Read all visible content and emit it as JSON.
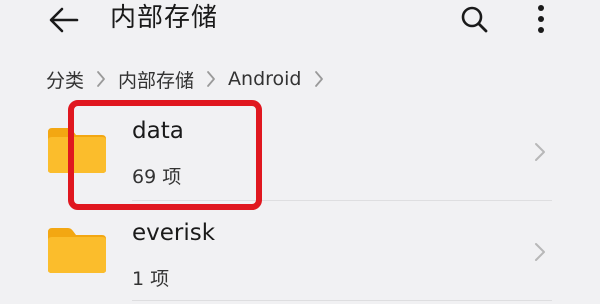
{
  "appbar": {
    "title": "内部存储",
    "icons": {
      "back": "arrow-left-icon",
      "search": "search-icon",
      "more": "more-vertical-icon"
    }
  },
  "breadcrumb": {
    "items": [
      "分类",
      "内部存储",
      "Android"
    ]
  },
  "folders": [
    {
      "name": "data",
      "count": "69 项"
    },
    {
      "name": "everisk",
      "count": "1 项"
    }
  ],
  "colors": {
    "background": "#f1f1f3",
    "folder": "#f8b21e",
    "highlight": "#e0171f"
  }
}
